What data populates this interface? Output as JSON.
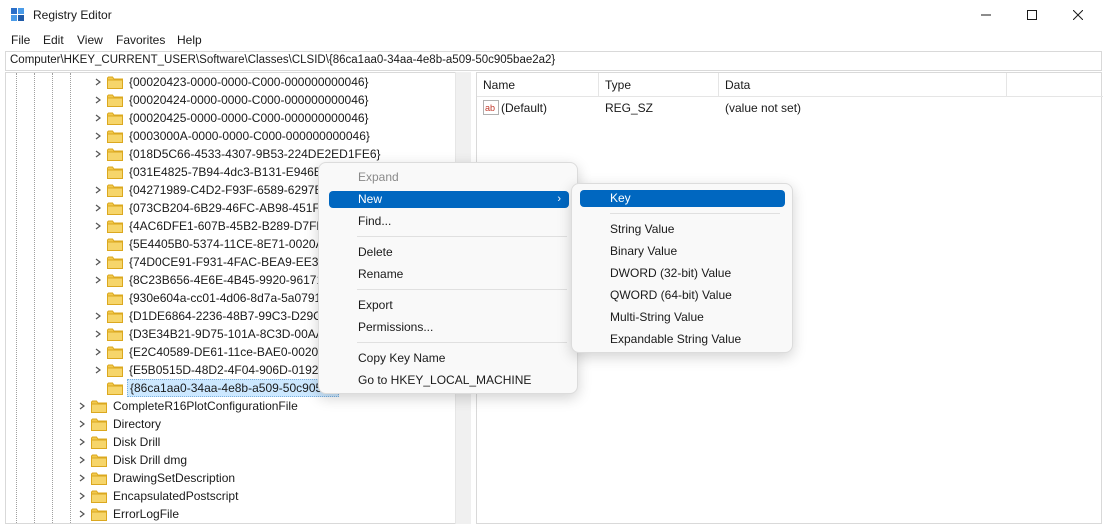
{
  "window": {
    "title": "Registry Editor",
    "icon": "registry-editor-icon",
    "controls": [
      "minimize-icon",
      "maximize-icon",
      "close-icon"
    ]
  },
  "menubar": [
    "File",
    "Edit",
    "View",
    "Favorites",
    "Help"
  ],
  "address": "Computer\\HKEY_CURRENT_USER\\Software\\Classes\\CLSID\\{86ca1aa0-34aa-4e8b-a509-50c905bae2a2}",
  "tree": {
    "guid_items": [
      "{00020423-0000-0000-C000-000000000046}",
      "{00020424-0000-0000-C000-000000000046}",
      "{00020425-0000-0000-C000-000000000046}",
      "{0003000A-0000-0000-C000-000000000046}",
      "{018D5C66-4533-4307-9B53-224DE2ED1FE6}",
      "{031E4825-7B94-4dc3-B131-E946B44C",
      "{04271989-C4D2-F93F-6589-6297B5A",
      "{073CB204-6B29-46FC-AB98-451F1D0",
      "{4AC6DFE1-607B-45B2-B289-D7FBCD",
      "{5E4405B0-5374-11CE-8E71-0020AF0",
      "{74D0CE91-F931-4FAC-BEA9-EE32E43",
      "{8C23B656-4E6E-4B45-9920-9617168",
      "{930e604a-cc01-4d06-8d7a-5a07914f",
      "{D1DE6864-2236-48B7-99C3-D29C757",
      "{D3E34B21-9D75-101A-8C3D-00AA00",
      "{E2C40589-DE61-11ce-BAE0-0020AF6",
      "{E5B0515D-48D2-4F04-906D-0192ED6",
      "{86ca1aa0-34aa-4e8b-a509-50c905ba"
    ],
    "root_items": [
      "CompleteR16PlotConfigurationFile",
      "Directory",
      "Disk Drill",
      "Disk Drill dmg",
      "DrawingSetDescription",
      "EncapsulatedPostscript",
      "ErrorLogFile"
    ]
  },
  "list": {
    "columns": [
      "Name",
      "Type",
      "Data"
    ],
    "rows": [
      {
        "icon": "string-value-icon",
        "name": "(Default)",
        "type": "REG_SZ",
        "data": "(value not set)"
      }
    ]
  },
  "context_menu": {
    "expand": "Expand",
    "new": "New",
    "find": "Find...",
    "delete": "Delete",
    "rename": "Rename",
    "export": "Export",
    "permissions": "Permissions...",
    "copy_key_name": "Copy Key Name",
    "goto_hklm": "Go to HKEY_LOCAL_MACHINE",
    "arrow": "›"
  },
  "sub_menu": {
    "key": "Key",
    "string_value": "String Value",
    "binary_value": "Binary Value",
    "dword_value": "DWORD (32-bit) Value",
    "qword_value": "QWORD (64-bit) Value",
    "multi_string_value": "Multi-String Value",
    "expandable_string_value": "Expandable String Value"
  },
  "colors": {
    "folder": "#f2c94c",
    "folder_dark": "#dba81f",
    "highlight": "#0067c0",
    "selection": "#cce8ff"
  }
}
